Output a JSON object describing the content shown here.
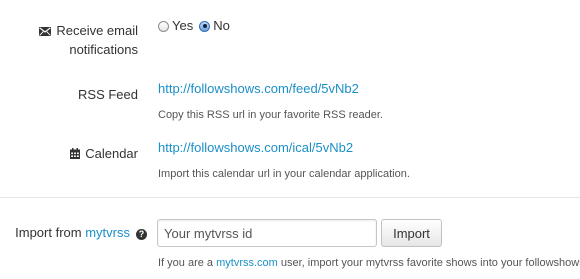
{
  "email_notifications": {
    "label_line1": "Receive email",
    "label_line2": "notifications",
    "icon": "envelope-icon",
    "options": [
      {
        "label": "Yes",
        "checked": false
      },
      {
        "label": "No",
        "checked": true
      }
    ]
  },
  "rss": {
    "label": "RSS Feed",
    "url": "http://followshows.com/feed/5vNb2",
    "help": "Copy this RSS url in your favorite RSS reader."
  },
  "calendar": {
    "label": "Calendar",
    "icon": "calendar-icon",
    "url": "http://followshows.com/ical/5vNb2",
    "help": "Import this calendar url in your calendar application."
  },
  "import": {
    "label_prefix": "Import from ",
    "label_link": "mytvrss",
    "help_icon": "question-circle-icon",
    "input_placeholder": "Your mytvrss id",
    "input_value": "",
    "button_label": "Import",
    "help_prefix": "If you are a ",
    "help_link": "mytvrss.com",
    "help_suffix": " user, import your mytvrss favorite shows into your followshows"
  },
  "colors": {
    "link": "#1b8fc7",
    "text": "#333333",
    "divider": "#e5e5e5"
  }
}
